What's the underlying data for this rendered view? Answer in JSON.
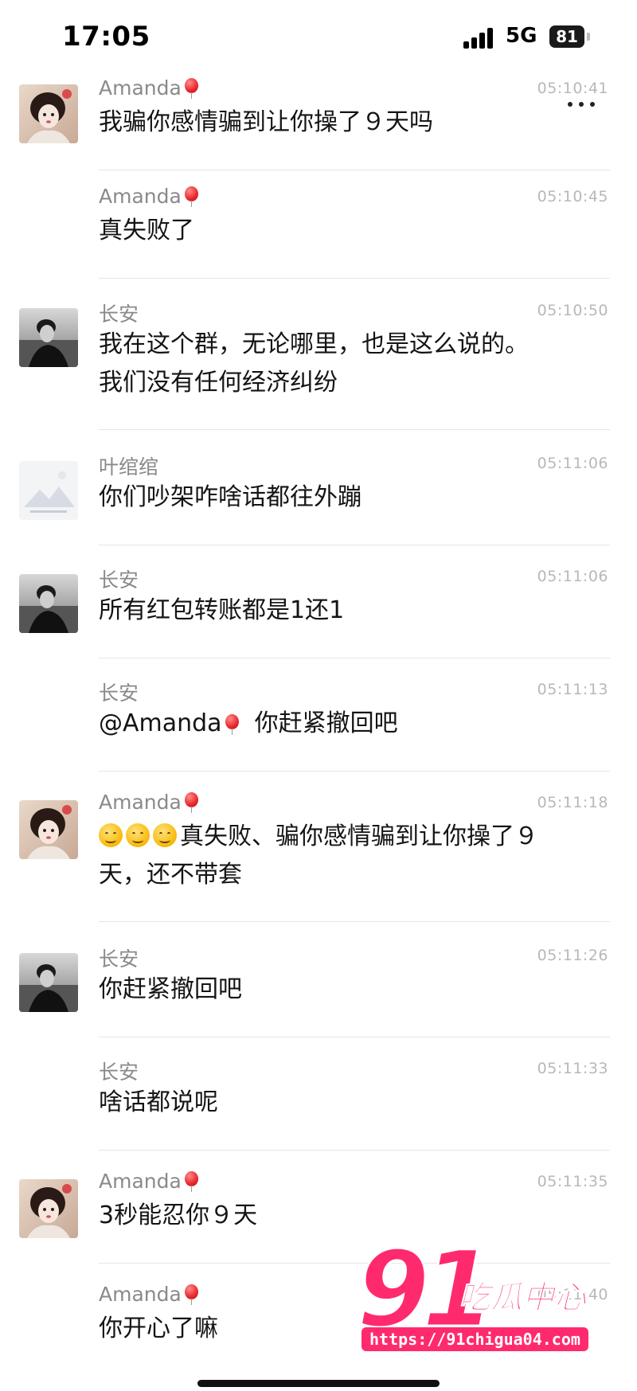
{
  "status_bar": {
    "time": "17:05",
    "network": "5G",
    "battery": "81"
  },
  "messages": [
    {
      "sender": "Amanda",
      "time": "05:10:41",
      "text": "我骗你感情骗到让你操了９天吗"
    },
    {
      "sender": "Amanda",
      "time": "05:10:45",
      "text": "真失败了"
    },
    {
      "sender": "长安",
      "time": "05:10:50",
      "text_lines": [
        "我在这个群，无论哪里，也是这么说的。",
        "我们没有任何经济纠纷"
      ]
    },
    {
      "sender": "叶绾绾",
      "time": "05:11:06",
      "text": "你们吵架咋啥话都往外蹦"
    },
    {
      "sender": "长安",
      "time": "05:11:06",
      "text": "所有红包转账都是1还1"
    },
    {
      "sender": "长安",
      "time": "05:11:13",
      "mention": "@Amanda",
      "text": "你赶紧撤回吧"
    },
    {
      "sender": "Amanda",
      "time": "05:11:18",
      "text_lines": [
        "真失败、骗你感情骗到让你操了９",
        "天，还不带套"
      ]
    },
    {
      "sender": "长安",
      "time": "05:11:26",
      "text": "你赶紧撤回吧"
    },
    {
      "sender": "长安",
      "time": "05:11:33",
      "text": "啥话都说呢"
    },
    {
      "sender": "Amanda",
      "time": "05:11:35",
      "text": "3秒能忍你９天"
    },
    {
      "sender": "Amanda",
      "time": "05:11:40",
      "text": "你开心了嘛"
    }
  ],
  "icons": {
    "more": "more-dots-icon",
    "balloon": "balloon-icon",
    "emoji": "smile-emoji-icon"
  },
  "watermark": {
    "number": "91",
    "name": "吃瓜中心",
    "url": "https://91chigua04.com"
  },
  "colors": {
    "accent_watermark": "#ff2a6d",
    "sender": "#8a8a8a",
    "time": "#b8b8b8"
  }
}
